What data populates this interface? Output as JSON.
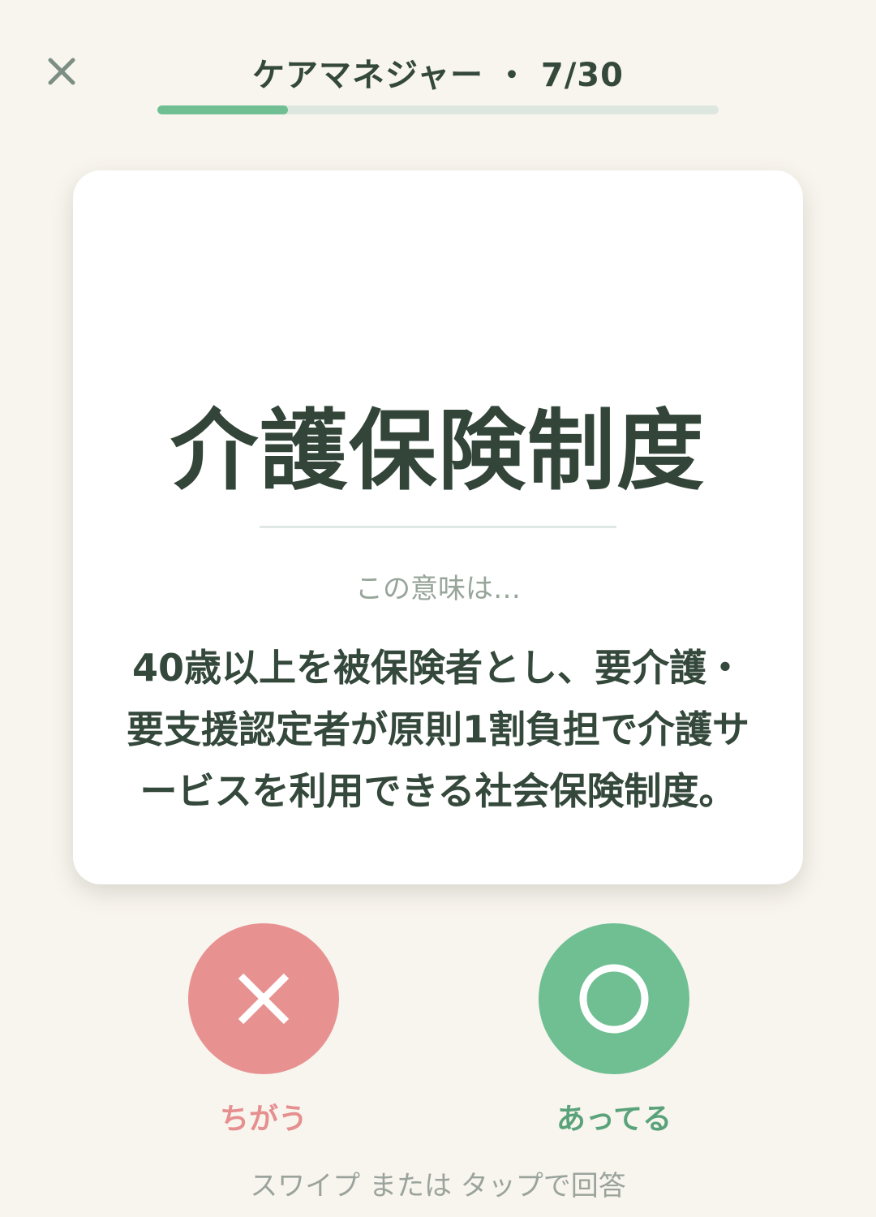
{
  "header": {
    "title": "ケアマネジャー ・ 7/30",
    "progress": {
      "current": 7,
      "total": 30
    }
  },
  "card": {
    "term": "介護保険制度",
    "subtitle": "この意味は…",
    "definition": "40歳以上を被保険者とし、要介護・要支援認定者が原則1割負担で介護サービスを利用できる社会保険制度。"
  },
  "actions": {
    "wrong_label": "ちがう",
    "right_label": "あってる"
  },
  "hint": "スワイプ または タップで回答",
  "colors": {
    "background": "#f8f5ee",
    "accent_green": "#6fbf93",
    "accent_red": "#e79291",
    "text_dark": "#34483b"
  },
  "icons": {
    "close": "close-icon",
    "wrong": "cross-icon",
    "right": "circle-icon"
  }
}
